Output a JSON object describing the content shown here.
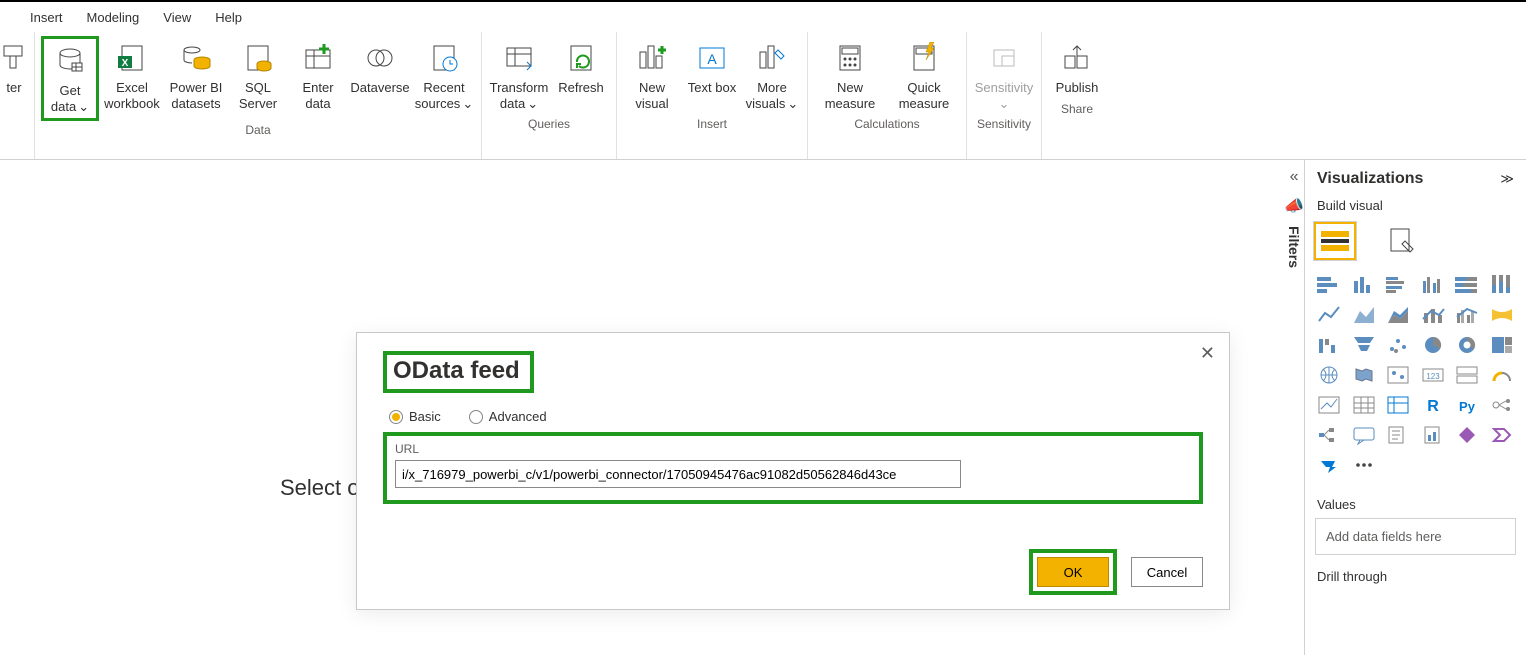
{
  "menubar": {
    "insert": "Insert",
    "modeling": "Modeling",
    "view": "View",
    "help": "Help"
  },
  "ribbon": {
    "painter_tail": "ter",
    "data": {
      "group": "Data",
      "get_data": "Get data",
      "get_data_caret": "⌄",
      "excel": "Excel workbook",
      "pbi_ds": "Power BI datasets",
      "sql": "SQL Server",
      "enter": "Enter data",
      "dataverse": "Dataverse",
      "recent": "Recent sources",
      "recent_caret": "⌄"
    },
    "queries": {
      "group": "Queries",
      "transform": "Transform data",
      "transform_caret": "⌄",
      "refresh": "Refresh"
    },
    "insert": {
      "group": "Insert",
      "new_visual": "New visual",
      "text_box": "Text box",
      "more": "More visuals",
      "more_caret": "⌄"
    },
    "calc": {
      "group": "Calculations",
      "new_measure": "New measure",
      "quick": "Quick measure"
    },
    "sens": {
      "group": "Sensitivity",
      "label": "Sensitivity",
      "caret": "⌄"
    },
    "share": {
      "group": "Share",
      "publish": "Publish"
    }
  },
  "canvas_hint": "Select or",
  "filters": {
    "label": "Filters",
    "chev": "«"
  },
  "viz_panel": {
    "title": "Visualizations",
    "expand": "≫",
    "build": "Build visual",
    "values": "Values",
    "values_placeholder": "Add data fields here",
    "drill": "Drill through"
  },
  "dialog": {
    "title": "OData feed",
    "basic": "Basic",
    "advanced": "Advanced",
    "url_label": "URL",
    "url_value": "i/x_716979_powerbi_c/v1/powerbi_connector/17050945476ac91082d50562846d43ce",
    "ok": "OK",
    "cancel": "Cancel"
  }
}
